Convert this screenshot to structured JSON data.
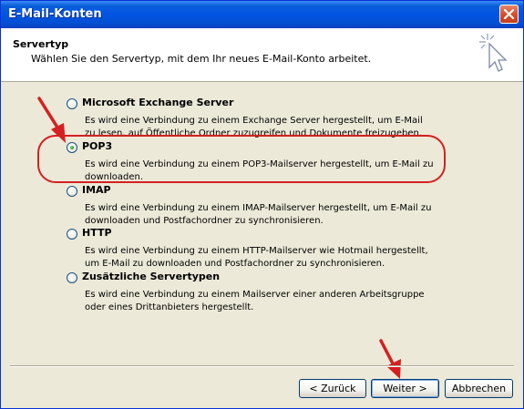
{
  "window": {
    "title": "E-Mail-Konten"
  },
  "header": {
    "title": "Servertyp",
    "subtitle": "Wählen Sie den Servertyp, mit dem Ihr neues E-Mail-Konto arbeitet."
  },
  "options": [
    {
      "label": "Microsoft Exchange Server",
      "checked": false,
      "description": "Es wird eine Verbindung zu einem Exchange Server hergestellt, um E-Mail zu lesen, auf Öffentliche Ordner zuzugreifen und Dokumente freizugeben."
    },
    {
      "label": "POP3",
      "checked": true,
      "description": "Es wird eine Verbindung zu einem POP3-Mailserver hergestellt, um E-Mail zu downloaden."
    },
    {
      "label": "IMAP",
      "checked": false,
      "description": "Es wird eine Verbindung zu einem IMAP-Mailserver hergestellt, um E-Mail zu downloaden und Postfachordner zu synchronisieren."
    },
    {
      "label": "HTTP",
      "checked": false,
      "description": "Es wird eine Verbindung zu einem HTTP-Mailserver wie Hotmail hergestellt, um E-Mail zu downloaden und Postfachordner zu synchronisieren."
    },
    {
      "label": "Zusätzliche Servertypen",
      "checked": false,
      "description": "Es wird eine Verbindung zu einem Mailserver einer anderen Arbeitsgruppe oder eines Drittanbieters hergestellt."
    }
  ],
  "buttons": {
    "back": "< Zurück",
    "next": "Weiter >",
    "cancel": "Abbrechen"
  },
  "colors": {
    "titlebar": "#0054e3",
    "dialog_bg": "#ece9d8",
    "annotation": "#d42020"
  },
  "icons": {
    "close": "close-icon",
    "wizard": "wizard-cursor-icon"
  }
}
